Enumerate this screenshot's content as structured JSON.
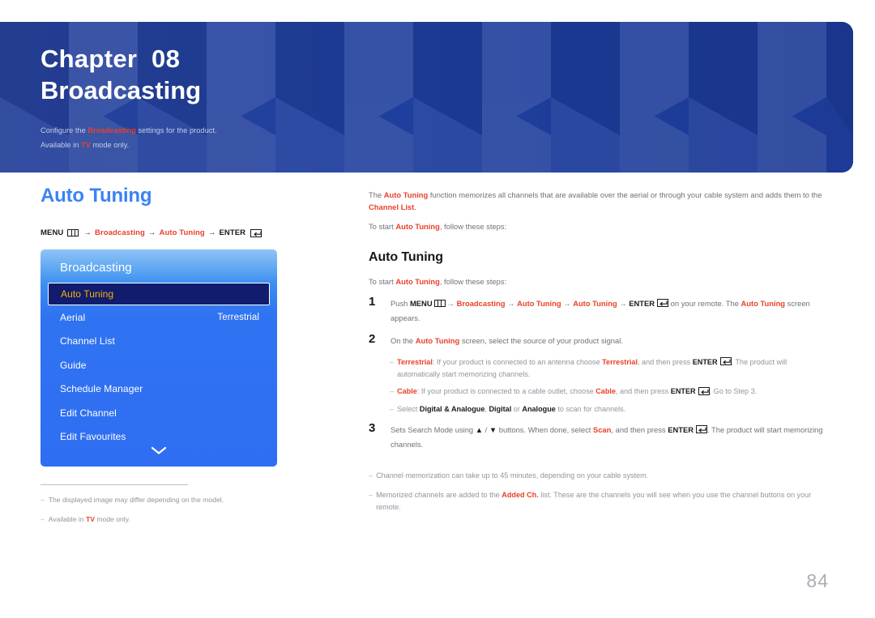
{
  "banner": {
    "chapter_label": "Chapter  08",
    "chapter_title": "Broadcasting",
    "sub_line1_a": "Configure the ",
    "sub_line1_hl": "Broadcasting",
    "sub_line1_b": " settings for the product.",
    "sub_line2_a": "Available in ",
    "sub_line2_hl": "TV",
    "sub_line2_b": " mode only.",
    "bg_color": "#1f3f9e"
  },
  "left": {
    "section_title": "Auto Tuning",
    "menu_path": {
      "menu_label": "MENU",
      "menu_icon": "menu-grid-icon",
      "arrow1": "→",
      "item1": "Broadcasting",
      "arrow2": "→",
      "item2": "Auto Tuning",
      "arrow3": "→",
      "enter_label": "ENTER",
      "enter_icon": "enter-return-icon"
    },
    "tv_panel": {
      "title": "Broadcasting",
      "accent_color": "#2f6ef2",
      "selected_text_color": "#f5b301",
      "rows": [
        {
          "label": "Auto Tuning",
          "value": "",
          "selected": true
        },
        {
          "label": "Aerial",
          "value": "Terrestrial",
          "selected": false
        },
        {
          "label": "Channel List",
          "value": "",
          "selected": false
        },
        {
          "label": "Guide",
          "value": "",
          "selected": false
        },
        {
          "label": "Schedule Manager",
          "value": "",
          "selected": false
        },
        {
          "label": "Edit Channel",
          "value": "",
          "selected": false
        },
        {
          "label": "Edit Favourites",
          "value": "",
          "selected": false
        }
      ],
      "scroll_icon": "chevron-down-icon"
    },
    "notes": [
      {
        "dash": "–",
        "text": "The displayed image may differ depending on the model."
      },
      {
        "dash": "–",
        "pre": "Available in ",
        "hl": "TV",
        "post": " mode only."
      }
    ]
  },
  "right": {
    "intro1_a": "The ",
    "intro1_hl1": "Auto Tuning",
    "intro1_b": " function memorizes all channels that are available over the aerial or through your cable system and adds them to the ",
    "intro1_hl2": "Channel List",
    "intro1_c": ".",
    "intro2_a": "To start ",
    "intro2_hl": "Auto Tuning",
    "intro2_b": ", follow these steps:",
    "sub_head": "Auto Tuning",
    "intro3_a": "To start ",
    "intro3_hl": "Auto Tuning",
    "intro3_b": ", follow these steps:",
    "step1": {
      "num": "1",
      "a": "Push ",
      "menu_label": "MENU",
      "arrow1": "→",
      "hl1": "Broadcasting",
      "arrow2": "→",
      "hl2": "Auto Tuning",
      "arrow3": "→",
      "hl3": "Auto Tuning",
      "arrow4": "→",
      "enter_label": "ENTER",
      "b": " on your remote. The ",
      "hl4": "Auto Tuning",
      "c": " screen appears."
    },
    "step2": {
      "num": "2",
      "a": "On the ",
      "hl": "Auto Tuning",
      "b": " screen, select the source of your product signal."
    },
    "step2_bullets": [
      {
        "dash": "–",
        "hl1": "Terrestrial",
        "a": ": If your product is connected to an antenna choose ",
        "hl2": "Terrestrial",
        "b": ", and then press ",
        "enter_label": "ENTER",
        "c": ". The product will automatically start memorizing channels."
      },
      {
        "dash": "–",
        "hl1": "Cable",
        "a": ": If your product is connected to a cable outlet, choose ",
        "hl2": "Cable",
        "b": ", and then press ",
        "enter_label": "ENTER",
        "c": ". Go to Step 3."
      }
    ],
    "step2_bullet3": {
      "dash": "–",
      "a": "Select ",
      "hl1": "Digital & Analogue",
      "b": ", ",
      "hl2": "Digital",
      "c": " or ",
      "hl3": "Analogue",
      "d": " to scan for channels."
    },
    "step3": {
      "num": "3",
      "a": "Sets Search Mode using ",
      "up_icon": "▲",
      "slash": " / ",
      "down_icon": "▼",
      "b": " buttons. When done, select ",
      "hl": "Scan",
      "c": ", and then press ",
      "enter_label": "ENTER",
      "d": ". The product will start memorizing channels."
    },
    "end_notes": [
      {
        "dash": "–",
        "text": "Channel memorization can take up to 45 minutes, depending on your cable system."
      },
      {
        "dash": "–",
        "pre": "Memorized channels are added to the ",
        "hl": "Added Ch.",
        "post": " list. These are the channels you will see when you use the channel buttons on your remote."
      }
    ]
  },
  "page_number": "84"
}
